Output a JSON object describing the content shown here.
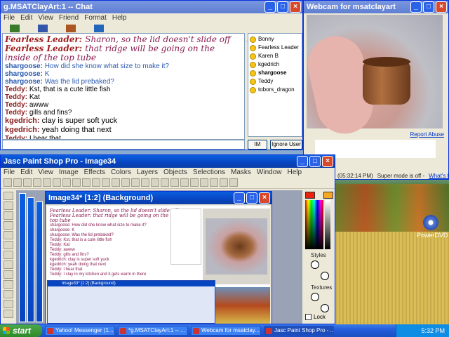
{
  "chat_window": {
    "title": "g.MSATClayArt:1 -- Chat",
    "menu": [
      "File",
      "Edit",
      "View",
      "Friend",
      "Format",
      "Help"
    ],
    "toolbar": [
      "Send File",
      "Webcam",
      "Voice",
      "Chat"
    ],
    "messages": [
      {
        "who": "Fearless Leader:",
        "msg": "Sharon, so the lid doesn't slide off",
        "style": "fancy",
        "cls": "w-fearless"
      },
      {
        "who": "Fearless Leader:",
        "msg": "that ridge will be going on the inside of the top tube",
        "style": "fancy",
        "cls": "w-fearless"
      },
      {
        "who": "shargoose:",
        "msg": "How did she know what size to make it?",
        "style": "blue",
        "cls": "w-shargoose"
      },
      {
        "who": "shargoose:",
        "msg": "K",
        "style": "blue",
        "cls": "w-shargoose"
      },
      {
        "who": "shargoose:",
        "msg": "Was the lid prebaked?",
        "style": "blue",
        "cls": "w-shargoose"
      },
      {
        "who": "Teddy:",
        "msg": "Kst, that is a cute little fish",
        "style": "",
        "cls": "w-teddy"
      },
      {
        "who": "Teddy:",
        "msg": "Kat",
        "style": "",
        "cls": "w-teddy"
      },
      {
        "who": "Teddy:",
        "msg": "awww",
        "style": "",
        "cls": "w-teddy"
      },
      {
        "who": "Teddy:",
        "msg": "gills and fins?",
        "style": "",
        "cls": "w-teddy"
      },
      {
        "who": "kgedrich:",
        "msg": "clay is super soft yuck",
        "style": "big",
        "cls": "w-kgedrich"
      },
      {
        "who": "kgedrich:",
        "msg": "yeah doing that next",
        "style": "big",
        "cls": "w-kgedrich"
      },
      {
        "who": "Teddy:",
        "msg": "I hear that",
        "style": "",
        "cls": "w-teddy"
      },
      {
        "who": "Teddy:",
        "msg": "I clay in my kitchen and it gets warm in there",
        "style": "",
        "cls": "w-teddy"
      }
    ],
    "buddies": [
      {
        "name": "Bonny",
        "bold": false
      },
      {
        "name": "Fearless Leader",
        "bold": false
      },
      {
        "name": "Karen B",
        "bold": false
      },
      {
        "name": "kgedrich",
        "bold": false
      },
      {
        "name": "shargoose",
        "bold": true
      },
      {
        "name": "Teddy",
        "bold": false
      },
      {
        "name": "tobors_dragon",
        "bold": false
      }
    ],
    "im_button": "IM",
    "ignore_button": "Ignore User"
  },
  "webcam_window": {
    "title": "Webcam for msatclayart",
    "report_abuse": "Report Abuse",
    "timestamp": "(05:32:14 PM)",
    "super_mode": "Super mode is off -",
    "whats_this": "What's this?"
  },
  "psp_window": {
    "title": "Jasc Paint Shop Pro - Image34",
    "menu": [
      "File",
      "Edit",
      "View",
      "Image",
      "Effects",
      "Colors",
      "Layers",
      "Objects",
      "Selections",
      "Masks",
      "Window",
      "Help"
    ],
    "palette_labels": {
      "styles": "Styles",
      "textures": "Textures",
      "lock": "Lock"
    }
  },
  "image_window": {
    "title": "Image34* [1:2] (Background)",
    "mini_lines": [
      "Fearless Leader: Sharon, so the lid doesn't slide off",
      "Fearless Leader: that ridge will be going on the inside of the",
      "top tube",
      "shargoose: How did she know what size to make it?",
      "shargoose: K",
      "shargoose: Was the lid prebaked?",
      "Teddy: Kst, that is a cute little fish",
      "Teddy: Kat",
      "Teddy: awww",
      "Teddy: gills and fins?",
      "kgedrich: clay is super soft yuck",
      "kgedrich: yeah doing that next",
      "Teddy: I hear that",
      "Teddy: I clay in my kitchen and it gets warm in there"
    ],
    "nested_title": "Image33* [1:2] (Background)"
  },
  "desktop_icon": "PowerDVD",
  "taskbar": {
    "start": "start",
    "tasks": [
      {
        "label": "Yahoo! Messenger (1...",
        "active": false
      },
      {
        "label": "*g.MSATClayArt:1 -- ...",
        "active": false
      },
      {
        "label": "Webcam for msatclay...",
        "active": false
      },
      {
        "label": "Jasc Paint Shop Pro - ...",
        "active": true
      }
    ],
    "clock": "5:32 PM"
  }
}
